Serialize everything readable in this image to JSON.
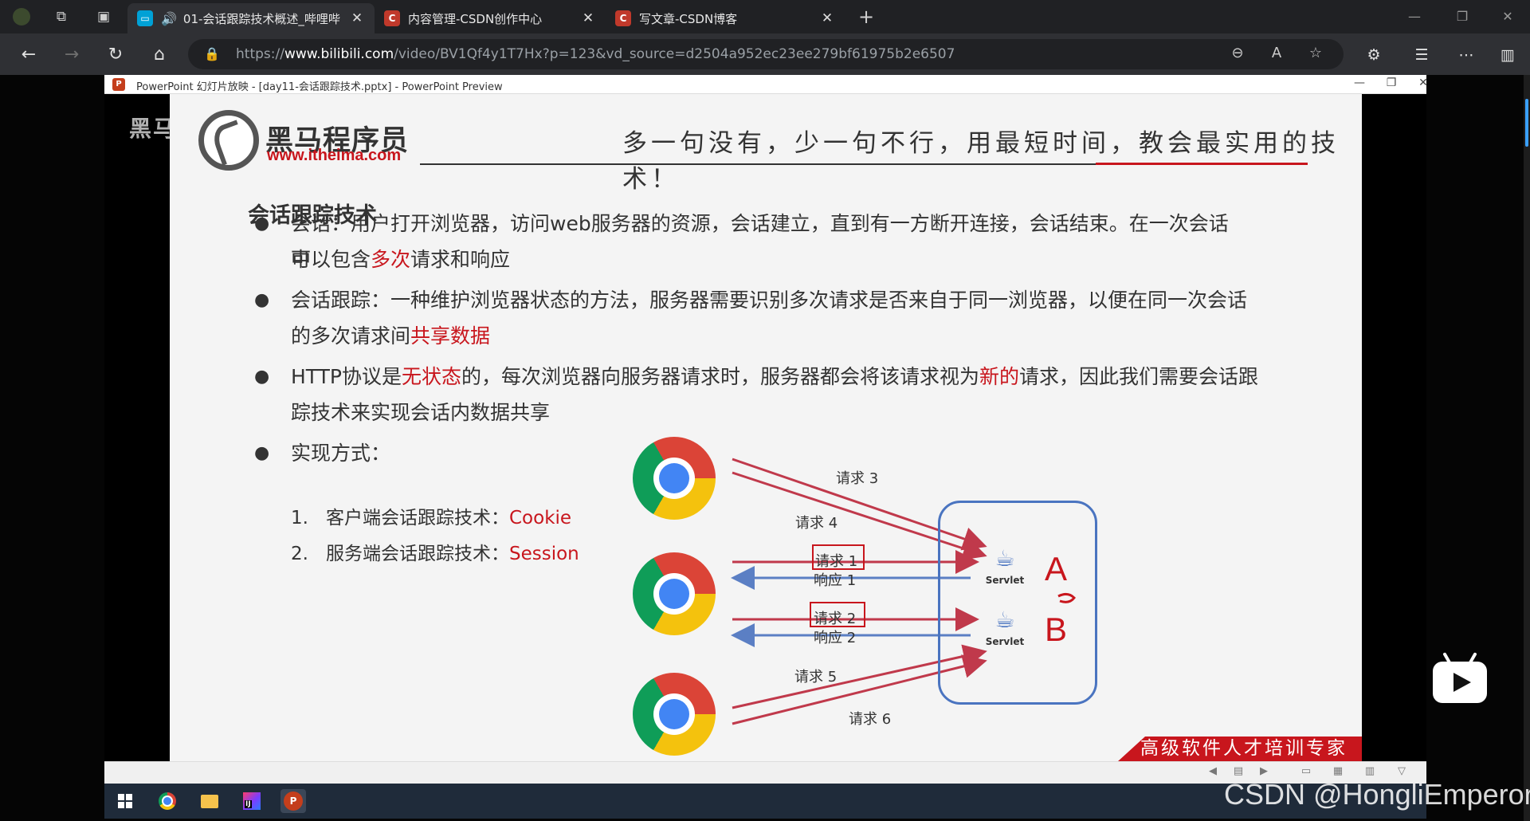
{
  "tabs": [
    {
      "title": "01-会话跟踪技术概述_哔哩哔",
      "active": true,
      "favicon_color": "#00a1d6"
    },
    {
      "title": "内容管理-CSDN创作中心",
      "active": false,
      "favicon_color": "#c0392b"
    },
    {
      "title": "写文章-CSDN博客",
      "active": false,
      "favicon_color": "#c0392b"
    }
  ],
  "address": {
    "prefix": "https://",
    "domain": "www.bilibili.com",
    "path": "/video/BV1Qf4y1T7Hx?p=123&vd_source=d2504a952ec23ee279bf61975b2e6507"
  },
  "ppt": {
    "window_title": "PowerPoint 幻灯片放映 - [day11-会话跟踪技术.pptx] - PowerPoint Preview"
  },
  "slide": {
    "shadow_brand": "黑马程",
    "logo_cn": "黑马程序员",
    "logo_url": "www.itheima.com",
    "slogan": "多一句没有，少一句不行，用最短时间，教会最实用的技术！",
    "heading": "会话跟踪技术",
    "bullets": [
      {
        "l1a": "会话：用户打开浏览器，访问web服务器的资源，会话建立，直到有一方断开连接，会话结束。在一次会话中",
        "l2a": "可以包含",
        "l2red": "多次",
        "l2b": "请求和响应"
      },
      {
        "l1a": "会话跟踪：一种维护浏览器状态的方法，服务器需要识别多次请求是否来自于同一浏览器，以便在同一次会话",
        "l2a": "的多次请求间",
        "l2red": "共享数据",
        "l2b": ""
      },
      {
        "l1a": "HTTP协议是",
        "l1red": "无状态",
        "l1b": "的，每次浏览器向服务器请求时，服务器都会将该请求视为",
        "l1red2": "新的",
        "l1c": "请求，因此我们需要会话跟",
        "l2a": "踪技术来实现会话内数据共享"
      },
      {
        "l1a": "实现方式："
      }
    ],
    "methods": [
      {
        "num": "1.",
        "label": "客户端会话跟踪技术：",
        "value": "Cookie"
      },
      {
        "num": "2.",
        "label": "服务端会话跟踪技术：",
        "value": "Session"
      }
    ],
    "diagram": {
      "req3": "请求 3",
      "req4": "请求 4",
      "req1": "请求 1",
      "resp1": "响应 1",
      "req2": "请求 2",
      "resp2": "响应 2",
      "req5": "请求 5",
      "req6": "请求 6",
      "servlet": "Servlet",
      "a": "A",
      "b": "B"
    },
    "banner": "高级软件人才培训专家"
  },
  "watermark": "CSDN @HongliEmperor",
  "colors": {
    "accent_red": "#c8161d",
    "server_blue": "#4a74c0",
    "arrow_red": "#c0394b",
    "arrow_blue": "#5b7fc4"
  }
}
